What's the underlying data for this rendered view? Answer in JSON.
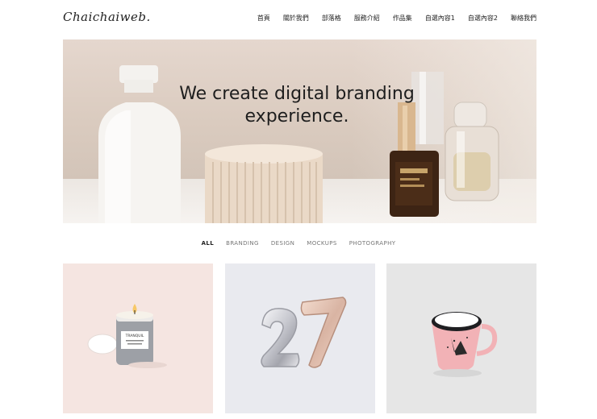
{
  "header": {
    "logo": "Chaichaiweb.",
    "nav": [
      "首頁",
      "關於我們",
      "部落格",
      "服務介紹",
      "作品集",
      "自選內容1",
      "自選內容2",
      "聯絡我們"
    ]
  },
  "hero": {
    "headline": "We create digital branding experience."
  },
  "filters": [
    "ALL",
    "BRANDING",
    "DESIGN",
    "MOCKUPS",
    "PHOTOGRAPHY"
  ],
  "filters_active": "ALL",
  "portfolio": {
    "items": [
      {
        "label": "TRANQUIL"
      },
      {
        "label": "27"
      },
      {
        "label": ""
      }
    ]
  }
}
